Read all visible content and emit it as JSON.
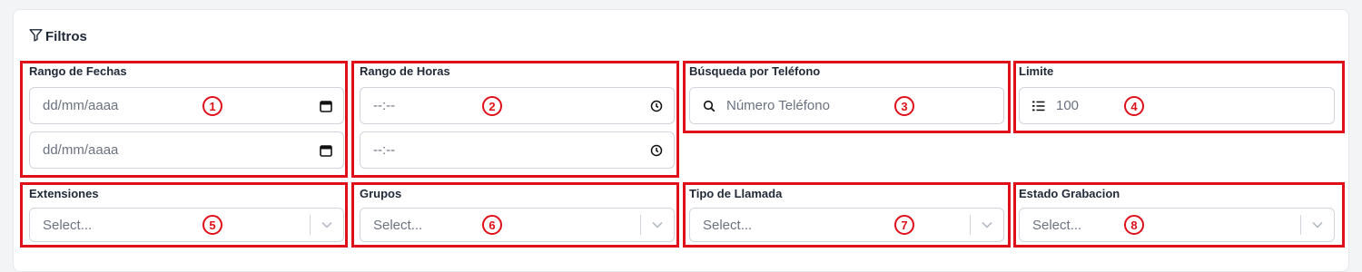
{
  "panel": {
    "title": "Filtros"
  },
  "date_range": {
    "label": "Rango de Fechas",
    "from_placeholder": "dd/mm/aaaa",
    "to_placeholder": "dd/mm/aaaa"
  },
  "time_range": {
    "label": "Rango de Horas",
    "from_placeholder": "--:--",
    "to_placeholder": "--:--"
  },
  "phone_search": {
    "label": "Búsqueda por Teléfono",
    "placeholder": "Número Teléfono"
  },
  "limit": {
    "label": "Limite",
    "value": "100"
  },
  "extensions": {
    "label": "Extensiones",
    "placeholder": "Select..."
  },
  "groups": {
    "label": "Grupos",
    "placeholder": "Select..."
  },
  "call_type": {
    "label": "Tipo de Llamada",
    "placeholder": "Select..."
  },
  "recording_status": {
    "label": "Estado Grabacion",
    "placeholder": "Select..."
  },
  "annotations": [
    "1",
    "2",
    "3",
    "4",
    "5",
    "6",
    "7",
    "8"
  ],
  "colors": {
    "annotation": "#e0101a",
    "text": "#1f2937",
    "muted": "#6b7280",
    "border": "#d1d5db"
  }
}
